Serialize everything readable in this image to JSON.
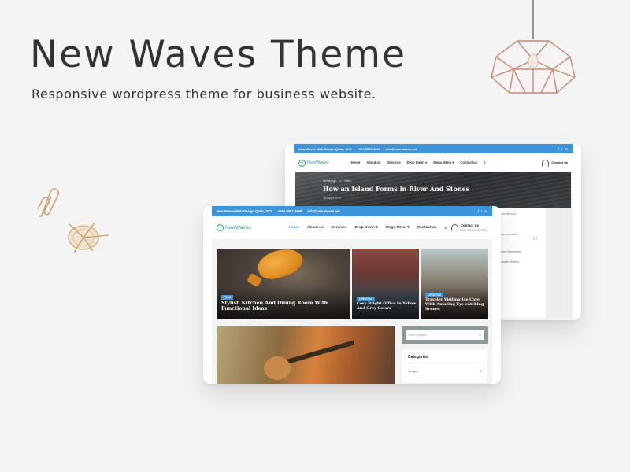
{
  "hero": {
    "title": "New Waves Theme",
    "subtitle": "Responsive wordpress theme for business website."
  },
  "colors": {
    "accent": "#3d94d8",
    "logo_green": "#2aa85a",
    "lamp": "#c98a6e",
    "background": "#f4f4f4"
  },
  "back_tablet": {
    "topbar": {
      "company": "New Waves Web Design Qatar, SCS",
      "phone": "+974 5557-4969",
      "email": "info@new-waves.net",
      "social": [
        "f",
        "t",
        "in"
      ]
    },
    "logo": {
      "part1": "New",
      "part2": "Waves"
    },
    "menu": [
      "Home",
      "About us",
      "Services",
      "Drop Down ▾",
      "Mega Menu ▾",
      "Contact us",
      "⌕"
    ],
    "contact": {
      "label": "Contact us",
      "sub": ""
    },
    "banner": {
      "crumbs": [
        "Homepage",
        "»",
        "Video"
      ],
      "title": "How an Island Forms in River And Stones",
      "date": "January 8, 2019"
    },
    "sidebar_lines": [
      "My invention architects of",
      "ages will",
      "your mighty class possible",
      "",
      "Nefit Good Game Wednesday",
      "New class possible Wellesa"
    ],
    "quote_mark": "”"
  },
  "front_tablet": {
    "topbar": {
      "company": "New Waves Web Design Qatar, SCS",
      "phone": "+974 5557-4969",
      "email": "info@new-waves.net",
      "social": [
        "f",
        "t",
        "in"
      ]
    },
    "logo": {
      "part1": "New",
      "part2": "Waves"
    },
    "menu": [
      "Home",
      "About us",
      "Services",
      "Drop Down ▾",
      "Mega Menu ▾",
      "Contact us",
      "⌕"
    ],
    "contact": {
      "label": "Contact us",
      "sub": "You are welcome"
    },
    "features": [
      {
        "tag": "FOOD",
        "title": "Stylish Kitchen And Dining Room With Functional Ideas"
      },
      {
        "tag": "LIFESTYLE",
        "title": "Cosy Bright Office In Yellow And Grey Colors"
      },
      {
        "tag": "LIFESTYLE",
        "title": "Traveler Visiting Ice Cave With Amazing Eye-catching Scenes"
      }
    ],
    "search": {
      "placeholder": "Enter Keyword",
      "icon": "⌕"
    },
    "categories": {
      "title": "Categories",
      "items": [
        {
          "label": "Images",
          "count": "1"
        }
      ]
    }
  }
}
